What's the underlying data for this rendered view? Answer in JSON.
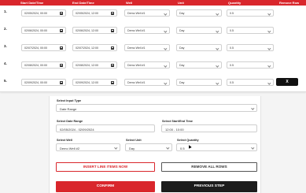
{
  "header": {
    "start": "Start Date/Time",
    "end": "End Date/Time",
    "well": "Well",
    "unit": "Unit",
    "quantity": "Quantity",
    "remove": "Remove Row"
  },
  "rows": [
    {
      "num": "1.",
      "start": "02/05/2024, 00:00",
      "end": "02/05/2024, 12:00",
      "well": "Demo Well #1",
      "unit": "Day",
      "qty": "0.5"
    },
    {
      "num": "2.",
      "start": "02/06/2024, 00:00",
      "end": "02/06/2024, 12:00",
      "well": "Demo Well #1",
      "unit": "Day",
      "qty": "0.5"
    },
    {
      "num": "3.",
      "start": "02/07/2024, 00:00",
      "end": "02/07/2024, 12:00",
      "well": "Demo Well #1",
      "unit": "Day",
      "qty": "0.5"
    },
    {
      "num": "4.",
      "start": "02/08/2024, 00:00",
      "end": "02/08/2024, 12:00",
      "well": "Demo Well #1",
      "unit": "Day",
      "qty": "0.5"
    },
    {
      "num": "5.",
      "start": "02/09/2024, 00:00",
      "end": "02/09/2024, 12:00",
      "well": "Demo Well #1",
      "unit": "Day",
      "qty": "0.5"
    }
  ],
  "remove_label": "X",
  "form": {
    "input_type_label": "Select Input Type",
    "input_type_value": "Date Range",
    "date_range_label": "Select Date Range",
    "date_range_value": "02/05/2024 - 02/09/2024",
    "time_label": "Select Start/End Time",
    "time_value": "12:00 - 10:00",
    "well_label": "Select Well",
    "well_value": "Demo Well #2",
    "unit_label": "Select Unit",
    "unit_value": "Day",
    "qty_label": "Select Quantity",
    "qty_value": "0.5"
  },
  "buttons": {
    "insert": "INSERT LINE ITEMS NOW",
    "remove_all": "REMOVE ALL ROWS",
    "confirm": "CONFIRM",
    "previous": "PREVIOUS STEP"
  },
  "colors": {
    "accent": "#d9262c",
    "dark": "#1c1c1c"
  }
}
